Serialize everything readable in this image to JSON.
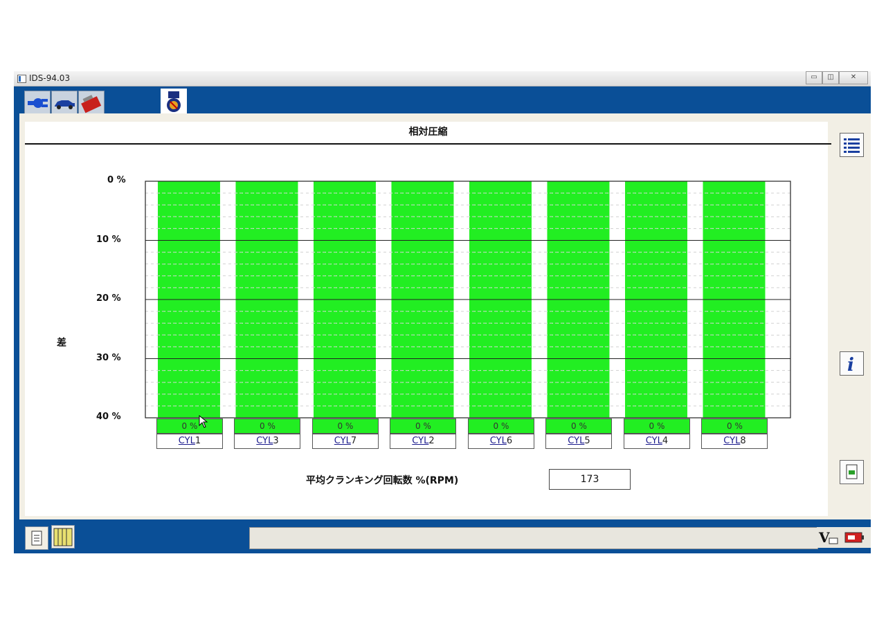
{
  "window": {
    "title": "IDS-94.03",
    "min": "▭",
    "restore": "◫",
    "close": "✕"
  },
  "tabs": [
    {
      "name": "connect",
      "icon": "plug-arrow-icon"
    },
    {
      "name": "vehicle",
      "icon": "car-icon"
    },
    {
      "name": "toolbox",
      "icon": "toolbox-icon"
    },
    {
      "name": "engine-test",
      "icon": "engine-globe-icon",
      "active": true
    }
  ],
  "page": {
    "title": "相対圧縮"
  },
  "chart_data": {
    "type": "bar",
    "ylabel": "差",
    "ytick_labels": [
      "0 %",
      "10 %",
      "20 %",
      "30 %",
      "40 %"
    ],
    "ylim": [
      0,
      40
    ],
    "y_inverted": true,
    "categories": [
      "CYL1",
      "CYL3",
      "CYL7",
      "CYL2",
      "CYL6",
      "CYL5",
      "CYL4",
      "CYL8"
    ],
    "values": [
      0,
      0,
      0,
      0,
      0,
      0,
      0,
      0
    ],
    "value_labels": [
      "0 %",
      "0 %",
      "0 %",
      "0 %",
      "0 %",
      "0 %",
      "0 %",
      "0 %"
    ],
    "bar_color": "#22ee22",
    "grid": true
  },
  "cylinders": [
    {
      "prefix": "CYL",
      "num": "1"
    },
    {
      "prefix": "CYL",
      "num": "3"
    },
    {
      "prefix": "CYL",
      "num": "7"
    },
    {
      "prefix": "CYL",
      "num": "2"
    },
    {
      "prefix": "CYL",
      "num": "6"
    },
    {
      "prefix": "CYL",
      "num": "5"
    },
    {
      "prefix": "CYL",
      "num": "4"
    },
    {
      "prefix": "CYL",
      "num": "8"
    }
  ],
  "rpm": {
    "label": "平均クランキング回転数 %(RPM)",
    "value": "173"
  },
  "sidebar": [
    "list-icon",
    "info-icon",
    "export-icon"
  ],
  "statusbar": {
    "left_icons": [
      "document-icon",
      "module-rack-icon"
    ],
    "right_icons": [
      "voltage-icon",
      "battery-icon"
    ],
    "voltage_label": "V"
  },
  "colors": {
    "frame": "#0a4f97",
    "bar": "#22ee22"
  }
}
